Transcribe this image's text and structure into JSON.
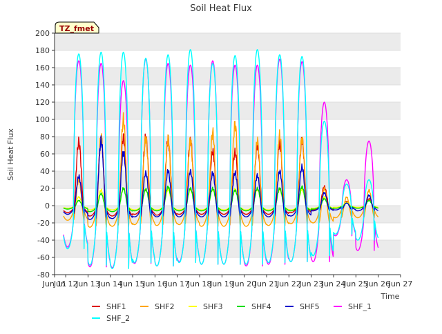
{
  "chart_data": {
    "type": "line",
    "title": "Soil Heat Flux",
    "xlabel": "Time",
    "ylabel": "Soil Heat Flux",
    "annotation": "TZ_fmet",
    "xlim": [
      11.5,
      27
    ],
    "ylim": [
      -80,
      200
    ],
    "x_ticks": [
      {
        "v": 11.5,
        "label": "Jun 11"
      },
      {
        "v": 12,
        "label": "Jun 12"
      },
      {
        "v": 13,
        "label": "Jun 13"
      },
      {
        "v": 14,
        "label": "Jun 14"
      },
      {
        "v": 15,
        "label": "Jun 15"
      },
      {
        "v": 16,
        "label": "Jun 16"
      },
      {
        "v": 17,
        "label": "Jun 17"
      },
      {
        "v": 18,
        "label": "Jun 18"
      },
      {
        "v": 19,
        "label": "Jun 19"
      },
      {
        "v": 20,
        "label": "Jun 20"
      },
      {
        "v": 21,
        "label": "Jun 21"
      },
      {
        "v": 22,
        "label": "Jun 22"
      },
      {
        "v": 23,
        "label": "Jun 23"
      },
      {
        "v": 24,
        "label": "Jun 24"
      },
      {
        "v": 25,
        "label": "Jun 25"
      },
      {
        "v": 26,
        "label": "Jun 26"
      },
      {
        "v": 27,
        "label": "Jun 27"
      }
    ],
    "y_ticks": [
      -80,
      -60,
      -40,
      -20,
      0,
      20,
      40,
      60,
      80,
      100,
      120,
      140,
      160,
      180,
      200
    ],
    "grid": true,
    "legend_position": "bottom",
    "series": [
      {
        "name": "SHF1",
        "color": "#dd0000",
        "amp": [
          74,
          76,
          80,
          79,
          76,
          76,
          63,
          62,
          70,
          72,
          75,
          22,
          5,
          8
        ],
        "trough": [
          -8,
          -12,
          -12,
          -10,
          -11,
          -10,
          -10,
          -10,
          -10,
          -10,
          -8,
          -5,
          -3,
          -3
        ]
      },
      {
        "name": "SHF2",
        "color": "#ffa500",
        "amp": [
          30,
          80,
          100,
          78,
          78,
          75,
          85,
          95,
          75,
          82,
          78,
          20,
          10,
          18
        ],
        "trough": [
          -17,
          -25,
          -24,
          -22,
          -23,
          -22,
          -24,
          -24,
          -24,
          -23,
          -21,
          -20,
          -14,
          -14
        ]
      },
      {
        "name": "SHF3",
        "color": "#ffff00",
        "amp": [
          10,
          18,
          20,
          19,
          19,
          19,
          19,
          19,
          19,
          19,
          19,
          10,
          4,
          6
        ],
        "trough": [
          -3,
          -5,
          -5,
          -5,
          -5,
          -5,
          -5,
          -5,
          -5,
          -5,
          -5,
          -3,
          -2,
          -2
        ]
      },
      {
        "name": "SHF4",
        "color": "#00dd00",
        "amp": [
          6,
          14,
          20,
          19,
          22,
          20,
          20,
          18,
          20,
          20,
          22,
          8,
          3,
          6
        ],
        "trough": [
          -4,
          -7,
          -7,
          -6,
          -6,
          -6,
          -6,
          -6,
          -6,
          -6,
          -6,
          -4,
          -3,
          -3
        ]
      },
      {
        "name": "SHF5",
        "color": "#0000cc",
        "amp": [
          34,
          75,
          62,
          38,
          40,
          40,
          38,
          38,
          35,
          40,
          45,
          15,
          3,
          12
        ],
        "trough": [
          -10,
          -16,
          -15,
          -13,
          -13,
          -13,
          -13,
          -13,
          -13,
          -13,
          -12,
          -6,
          -5,
          -6
        ]
      },
      {
        "name": "SHF_1",
        "color": "#ff00ff",
        "amp": [
          168,
          165,
          145,
          170,
          165,
          163,
          168,
          163,
          163,
          170,
          167,
          120,
          30,
          75
        ],
        "trough": [
          -48,
          -71,
          -72,
          -67,
          -70,
          -65,
          -68,
          -68,
          -70,
          -68,
          -65,
          -65,
          -35,
          -52
        ]
      },
      {
        "name": "SHF_2",
        "color": "#00ffff",
        "amp": [
          176,
          178,
          178,
          171,
          175,
          181,
          165,
          174,
          181,
          175,
          173,
          98,
          25,
          30
        ],
        "trough": [
          -50,
          -69,
          -73,
          -66,
          -70,
          -66,
          -68,
          -68,
          -68,
          -66,
          -65,
          -58,
          -33,
          -40
        ]
      }
    ]
  }
}
